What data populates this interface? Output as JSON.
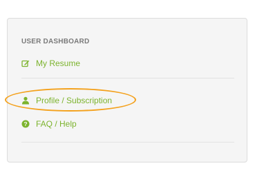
{
  "dashboard": {
    "heading": "USER DASHBOARD",
    "items": [
      {
        "label": "My Resume",
        "icon": "edit-icon"
      },
      {
        "label": "Profile / Subscription",
        "icon": "user-icon",
        "highlighted": true
      },
      {
        "label": "FAQ / Help",
        "icon": "question-circle-icon"
      }
    ]
  },
  "colors": {
    "link": "#7cb32d",
    "highlight": "#f4a11c",
    "heading": "#7a7a7a",
    "panel_bg": "#f5f5f5"
  }
}
